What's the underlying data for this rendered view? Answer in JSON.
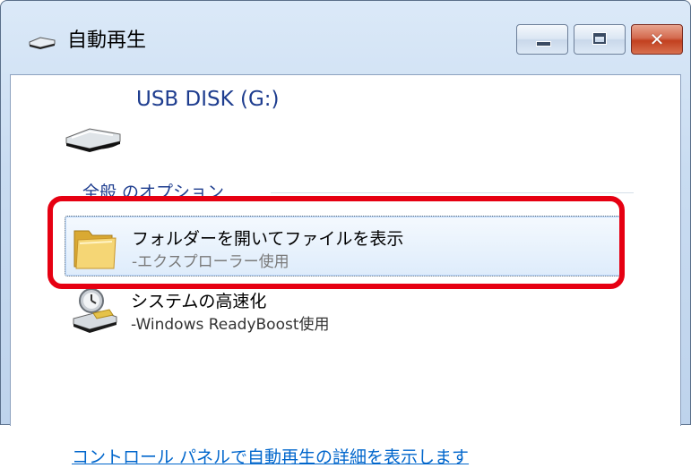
{
  "window": {
    "title": "自動再生"
  },
  "device": {
    "name": "USB DISK (G:)"
  },
  "group": {
    "label": "全般 のオプション"
  },
  "options": [
    {
      "title": "フォルダーを開いてファイルを表示",
      "subtitle": "-エクスプローラー使用"
    },
    {
      "title": "システムの高速化",
      "subtitle": "-Windows ReadyBoost使用"
    }
  ],
  "footer": {
    "control_panel_link": "コントロール パネルで自動再生の詳細を表示します"
  },
  "colors": {
    "highlight": "#e60012",
    "link": "#0066cc",
    "heading": "#1e3d8f"
  }
}
